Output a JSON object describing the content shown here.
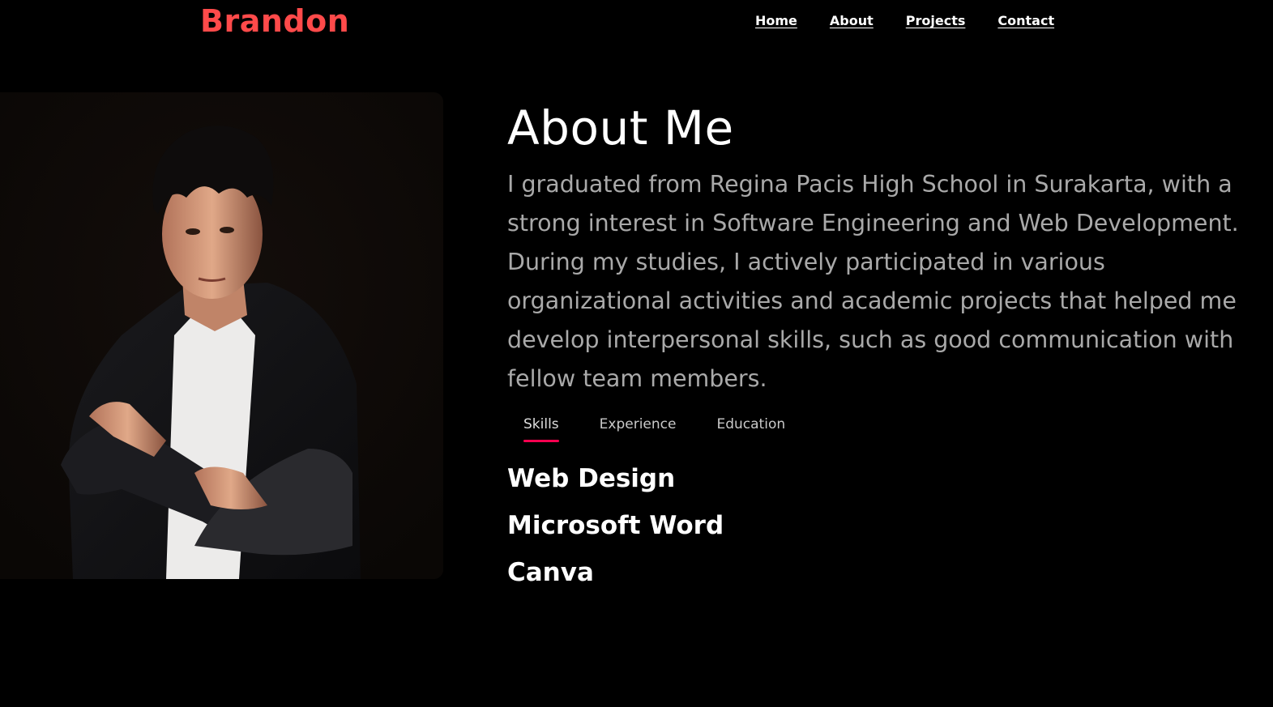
{
  "header": {
    "logo": "Brandon",
    "nav": [
      {
        "label": "Home"
      },
      {
        "label": "About"
      },
      {
        "label": "Projects"
      },
      {
        "label": "Contact"
      }
    ]
  },
  "about": {
    "title": "About Me",
    "description": "I graduated from Regina Pacis High School in Surakarta, with a strong interest in Software Engineering and Web Development. During my studies, I actively participated in various organizational activities and academic projects that helped me develop interpersonal skills, such as good communication with fellow team members.",
    "tabs": [
      {
        "label": "Skills",
        "active": true
      },
      {
        "label": "Experience",
        "active": false
      },
      {
        "label": "Education",
        "active": false
      }
    ],
    "skills": [
      "Web Design",
      "Microsoft Word",
      "Canva"
    ]
  },
  "colors": {
    "background": "#000000",
    "logo": "#ff4a4a",
    "accent": "#ff004f",
    "body_text": "#a9a9a9"
  }
}
